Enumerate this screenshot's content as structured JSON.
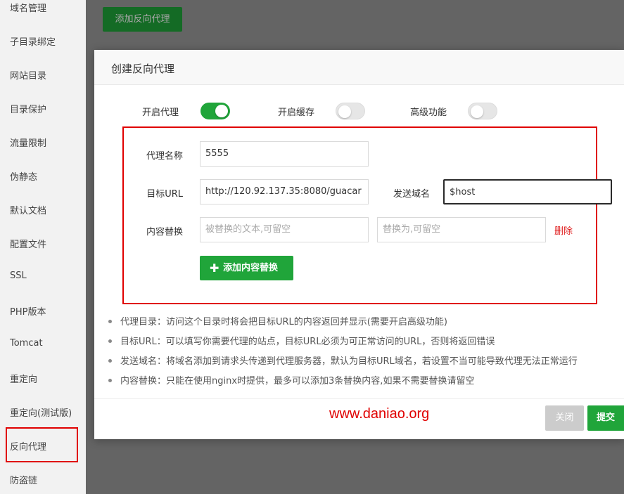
{
  "sidebar": {
    "items": [
      {
        "label": "域名管理"
      },
      {
        "label": "子目录绑定"
      },
      {
        "label": "网站目录"
      },
      {
        "label": "目录保护"
      },
      {
        "label": "流量限制"
      },
      {
        "label": "伪静态"
      },
      {
        "label": "默认文档"
      },
      {
        "label": "配置文件"
      },
      {
        "label": "SSL"
      },
      {
        "label": "PHP版本"
      },
      {
        "label": "Tomcat"
      },
      {
        "label": "重定向"
      },
      {
        "label": "重定向(测试版)"
      },
      {
        "label": "反向代理"
      },
      {
        "label": "防盗链"
      }
    ],
    "active": "反向代理"
  },
  "background": {
    "add_button": "添加反向代理"
  },
  "modal": {
    "title": "创建反向代理",
    "toggles": {
      "proxy": {
        "label": "开启代理",
        "on": true
      },
      "cache": {
        "label": "开启缓存",
        "on": false
      },
      "advanced": {
        "label": "高级功能",
        "on": false
      }
    },
    "fields": {
      "name_label": "代理名称",
      "name_value": "5555",
      "target_label": "目标URL",
      "target_value": "http://120.92.137.35:8080/guacar",
      "send_domain_label": "发送域名",
      "send_domain_value": "$host",
      "replace_label": "内容替换",
      "replace_from_placeholder": "被替换的文本,可留空",
      "replace_to_placeholder": "替换为,可留空",
      "delete_label": "删除"
    },
    "add_replace_button": "添加内容替换",
    "notes": [
      "代理目录：访问这个目录时将会把目标URL的内容返回并显示(需要开启高级功能)",
      "目标URL：可以填写你需要代理的站点，目标URL必须为可正常访问的URL，否则将返回错误",
      "发送域名：将域名添加到请求头传递到代理服务器，默认为目标URL域名，若设置不当可能导致代理无法正常运行",
      "内容替换：只能在使用nginx时提供，最多可以添加3条替换内容,如果不需要替换请留空"
    ],
    "footer": {
      "watermark": "www.daniao.org",
      "close_button": "关闭",
      "submit_button": "提交"
    }
  },
  "colors": {
    "brand_green": "#20a53a",
    "highlight_red": "#e00000"
  }
}
